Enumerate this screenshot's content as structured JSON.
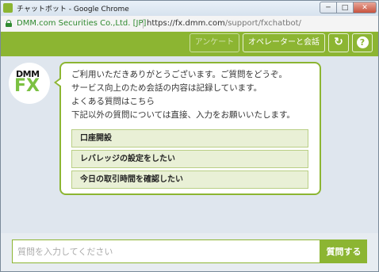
{
  "window": {
    "title": "チャットボット - Google Chrome",
    "controls": {
      "minimize": "─",
      "maximize": "□",
      "close": "✕"
    }
  },
  "address_bar": {
    "site_label": "DMM.com Securities Co.,Ltd. [JP]",
    "url_scheme": "https://",
    "url_host": "fx.dmm.com",
    "url_path": "/support/fxchatbot/"
  },
  "header": {
    "survey_label": "アンケート",
    "operator_label": "オペレーターと会話",
    "refresh_glyph": "↻",
    "help_glyph": "?"
  },
  "logo": {
    "line1": "DMM",
    "line2": "FX"
  },
  "message": {
    "lines": [
      "ご利用いただきありがとうございます。ご質問をどうぞ。",
      "サービス向上のため会話の内容は記録しています。",
      "よくある質問はこちら",
      "下記以外の質問については直接、入力をお願いいたします。"
    ],
    "options": [
      "口座開設",
      "レバレッジの設定をしたい",
      "今日の取引時間を確認したい"
    ]
  },
  "composer": {
    "placeholder": "質問を入力してください",
    "value": "",
    "send_label": "質問する"
  },
  "colors": {
    "accent": "#8cb532",
    "fx_green": "#7bc142",
    "chat_bg": "#dfe6ee"
  }
}
